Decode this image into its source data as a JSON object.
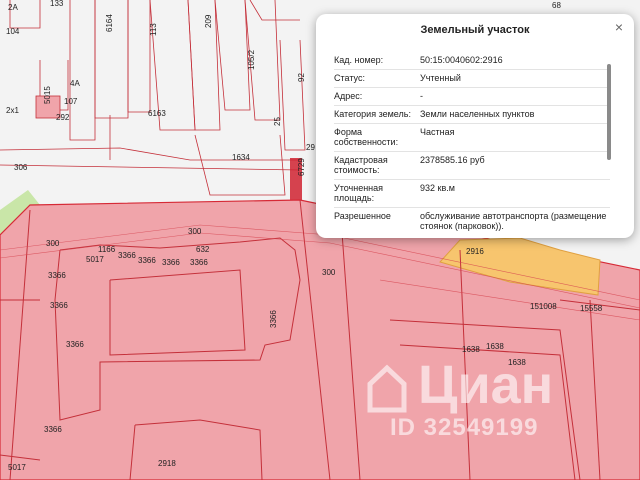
{
  "popup": {
    "title": "Земельный участок",
    "close_glyph": "×",
    "rows": [
      {
        "key": "Кад. номер:",
        "value": "50:15:0040602:2916"
      },
      {
        "key": "Статус:",
        "value": "Учтенный"
      },
      {
        "key": "Адрес:",
        "value": "-"
      },
      {
        "key": "Категория земель:",
        "value": "Земли населенных пунктов"
      },
      {
        "key": "Форма собственности:",
        "value": "Частная"
      },
      {
        "key": "Кадастровая стоимость:",
        "value": "2378585.16 руб"
      },
      {
        "key": "Уточненная площадь:",
        "value": "932 кв.м"
      },
      {
        "key": "Разрешенное",
        "value": "обслуживание автотранспорта (размещение стоянок (парковок))."
      }
    ]
  },
  "map_labels": {
    "l104": "104",
    "l2a": "2А",
    "l133": "133",
    "l2x1": "2х1",
    "l5015": "5015",
    "l4a": "4А",
    "l107": "107",
    "l292": "292",
    "l6164": "6164",
    "l113": "113",
    "l209": "209",
    "l6163": "6163",
    "l1052": "105/2",
    "l92": "92",
    "l98": "98",
    "l25": "25",
    "l1634": "1634",
    "l306": "306",
    "l6729": "6729",
    "l29": "29",
    "l300a": "300",
    "l300b": "300",
    "l300c": "300",
    "l1166": "1166",
    "l5017a": "5017",
    "l3366a": "3366",
    "l3366b": "3366",
    "l3366c": "3366",
    "l632": "632",
    "l3366d": "3366",
    "l3366e": "3366",
    "l3366f": "3366",
    "l3366g": "3366",
    "l3366h": "3366",
    "l3366i": "3366",
    "l2916": "2916",
    "l151008": "151008",
    "l15558": "15558",
    "l1638a": "1638",
    "l1638b": "1638",
    "l1638c": "1638",
    "l2918": "2918",
    "l5017b": "5017",
    "l68": "68"
  },
  "watermark": {
    "brand": "Циан",
    "id": "ID 32549199"
  },
  "colors": {
    "parcel_fill": "#f0a4aa",
    "parcel_line": "#d62a36",
    "selected_fill": "#f7c56e",
    "buildings": "#cf2230"
  }
}
